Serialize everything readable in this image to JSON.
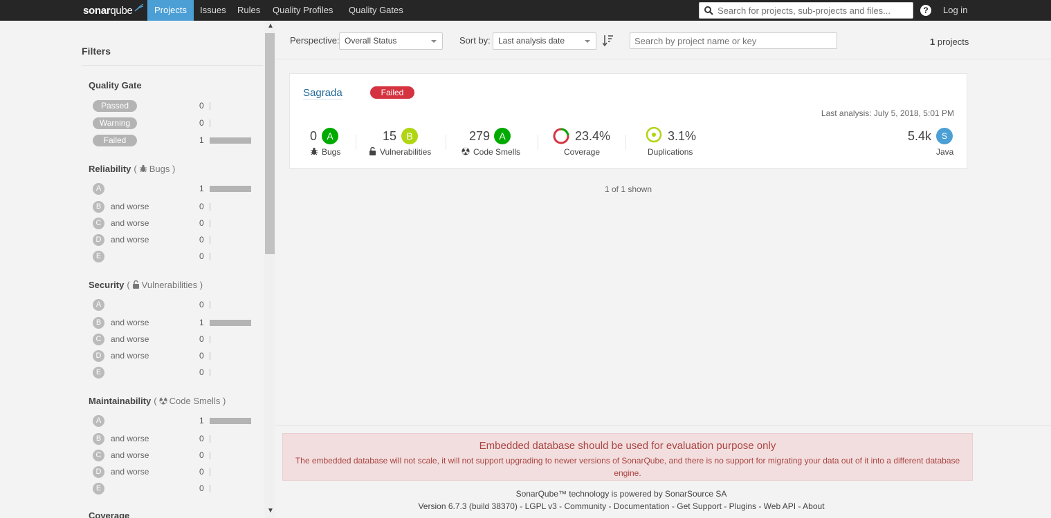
{
  "nav": {
    "logo_bold": "sonar",
    "logo_light": "qube",
    "items": [
      "Projects",
      "Issues",
      "Rules",
      "Quality Profiles",
      "Quality Gates"
    ],
    "search_placeholder": "Search for projects, sub-projects and files...",
    "help": "?",
    "login": "Log in"
  },
  "filters": {
    "title": "Filters",
    "quality_gate": {
      "title": "Quality Gate",
      "rows": [
        {
          "label": "Passed",
          "count": "0",
          "fraction": 0
        },
        {
          "label": "Warning",
          "count": "0",
          "fraction": 0
        },
        {
          "label": "Failed",
          "count": "1",
          "fraction": 1
        }
      ]
    },
    "reliability": {
      "title": "Reliability",
      "sub": "Bugs",
      "rows": [
        {
          "rating": "A",
          "suffix": "",
          "count": "1",
          "fraction": 1
        },
        {
          "rating": "B",
          "suffix": "and worse",
          "count": "0",
          "fraction": 0
        },
        {
          "rating": "C",
          "suffix": "and worse",
          "count": "0",
          "fraction": 0
        },
        {
          "rating": "D",
          "suffix": "and worse",
          "count": "0",
          "fraction": 0
        },
        {
          "rating": "E",
          "suffix": "",
          "count": "0",
          "fraction": 0
        }
      ]
    },
    "security": {
      "title": "Security",
      "sub": "Vulnerabilities",
      "rows": [
        {
          "rating": "A",
          "suffix": "",
          "count": "0",
          "fraction": 0
        },
        {
          "rating": "B",
          "suffix": "and worse",
          "count": "1",
          "fraction": 1
        },
        {
          "rating": "C",
          "suffix": "and worse",
          "count": "0",
          "fraction": 0
        },
        {
          "rating": "D",
          "suffix": "and worse",
          "count": "0",
          "fraction": 0
        },
        {
          "rating": "E",
          "suffix": "",
          "count": "0",
          "fraction": 0
        }
      ]
    },
    "maintainability": {
      "title": "Maintainability",
      "sub": "Code Smells",
      "rows": [
        {
          "rating": "A",
          "suffix": "",
          "count": "1",
          "fraction": 1
        },
        {
          "rating": "B",
          "suffix": "and worse",
          "count": "0",
          "fraction": 0
        },
        {
          "rating": "C",
          "suffix": "and worse",
          "count": "0",
          "fraction": 0
        },
        {
          "rating": "D",
          "suffix": "and worse",
          "count": "0",
          "fraction": 0
        },
        {
          "rating": "E",
          "suffix": "",
          "count": "0",
          "fraction": 0
        }
      ]
    },
    "coverage": {
      "title": "Coverage"
    }
  },
  "toolbar": {
    "perspective_label": "Perspective:",
    "perspective_value": "Overall Status",
    "sort_label": "Sort by:",
    "sort_value": "Last analysis date",
    "search_placeholder": "Search by project name or key",
    "count_num": "1",
    "count_text": "projects"
  },
  "project": {
    "name": "Sagrada",
    "quality_gate": "Failed",
    "last_analysis": "Last analysis: July 5, 2018, 5:01 PM",
    "bugs": {
      "value": "0",
      "rating": "A",
      "label": "Bugs"
    },
    "vulnerabilities": {
      "value": "15",
      "rating": "B",
      "label": "Vulnerabilities"
    },
    "code_smells": {
      "value": "279",
      "rating": "A",
      "label": "Code Smells"
    },
    "coverage": {
      "value": "23.4%",
      "label": "Coverage",
      "percent": 23.4
    },
    "duplications": {
      "value": "3.1%",
      "label": "Duplications",
      "percent": 3.1
    },
    "size": {
      "value": "5.4k",
      "avatar": "S",
      "language": "Java"
    }
  },
  "shown": "1 of 1 shown",
  "warning": {
    "title": "Embedded database should be used for evaluation purpose only",
    "text": "The embedded database will not scale, it will not support upgrading to newer versions of SonarQube, and there is no support for migrating your data out of it into a different database engine."
  },
  "footer": {
    "line1_prefix": "SonarQube™ technology is powered by ",
    "line1_link": "SonarSource SA",
    "version": "Version 6.7.3 (build 38370)",
    "links": [
      "LGPL v3",
      "Community",
      "Documentation",
      "Get Support",
      "Plugins",
      "Web API",
      "About"
    ]
  },
  "colors": {
    "nav_bg": "#262626",
    "nav_active": "#4b9fd5",
    "failed": "#d4333f",
    "rating_a": "#00aa00",
    "rating_b": "#b0d513",
    "coverage_ring": "#d4333f",
    "duplications_ring": "#b0d513",
    "link": "#236a97"
  }
}
